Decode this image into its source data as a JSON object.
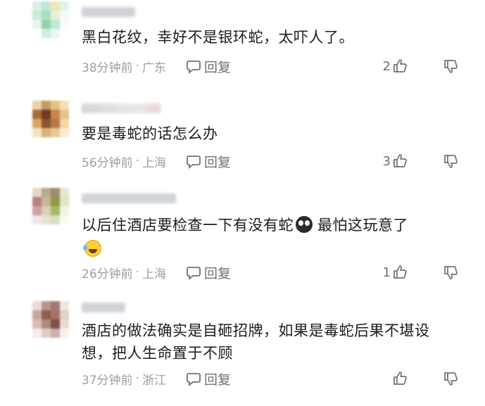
{
  "comments": [
    {
      "text": "黑白花纹，幸好不是银环蛇，太吓人了。",
      "time": "38分钟前",
      "location": "广东",
      "reply_label": "回复",
      "likes": "2"
    },
    {
      "text": "要是毒蛇的话怎么办",
      "time": "56分钟前",
      "location": "上海",
      "reply_label": "回复",
      "likes": "3"
    },
    {
      "text_part1": "以后住酒店要检查一下有没有蛇",
      "text_part2": "最怕这玩意了",
      "emoji1": "scared-face-emoji",
      "emoji2": "laughing-tears-emoji",
      "time": "26分钟前",
      "location": "上海",
      "reply_label": "回复",
      "likes": "1"
    },
    {
      "text": "酒店的做法确实是自砸招牌，如果是毒蛇后果不堪设想，把人生命置于不顾",
      "time": "37分钟前",
      "location": "浙江",
      "reply_label": "回复",
      "likes": ""
    }
  ],
  "separator": "·",
  "icons": {
    "reply": "comment-bubble-icon",
    "like": "thumbs-up-icon",
    "dislike": "thumbs-down-icon"
  }
}
